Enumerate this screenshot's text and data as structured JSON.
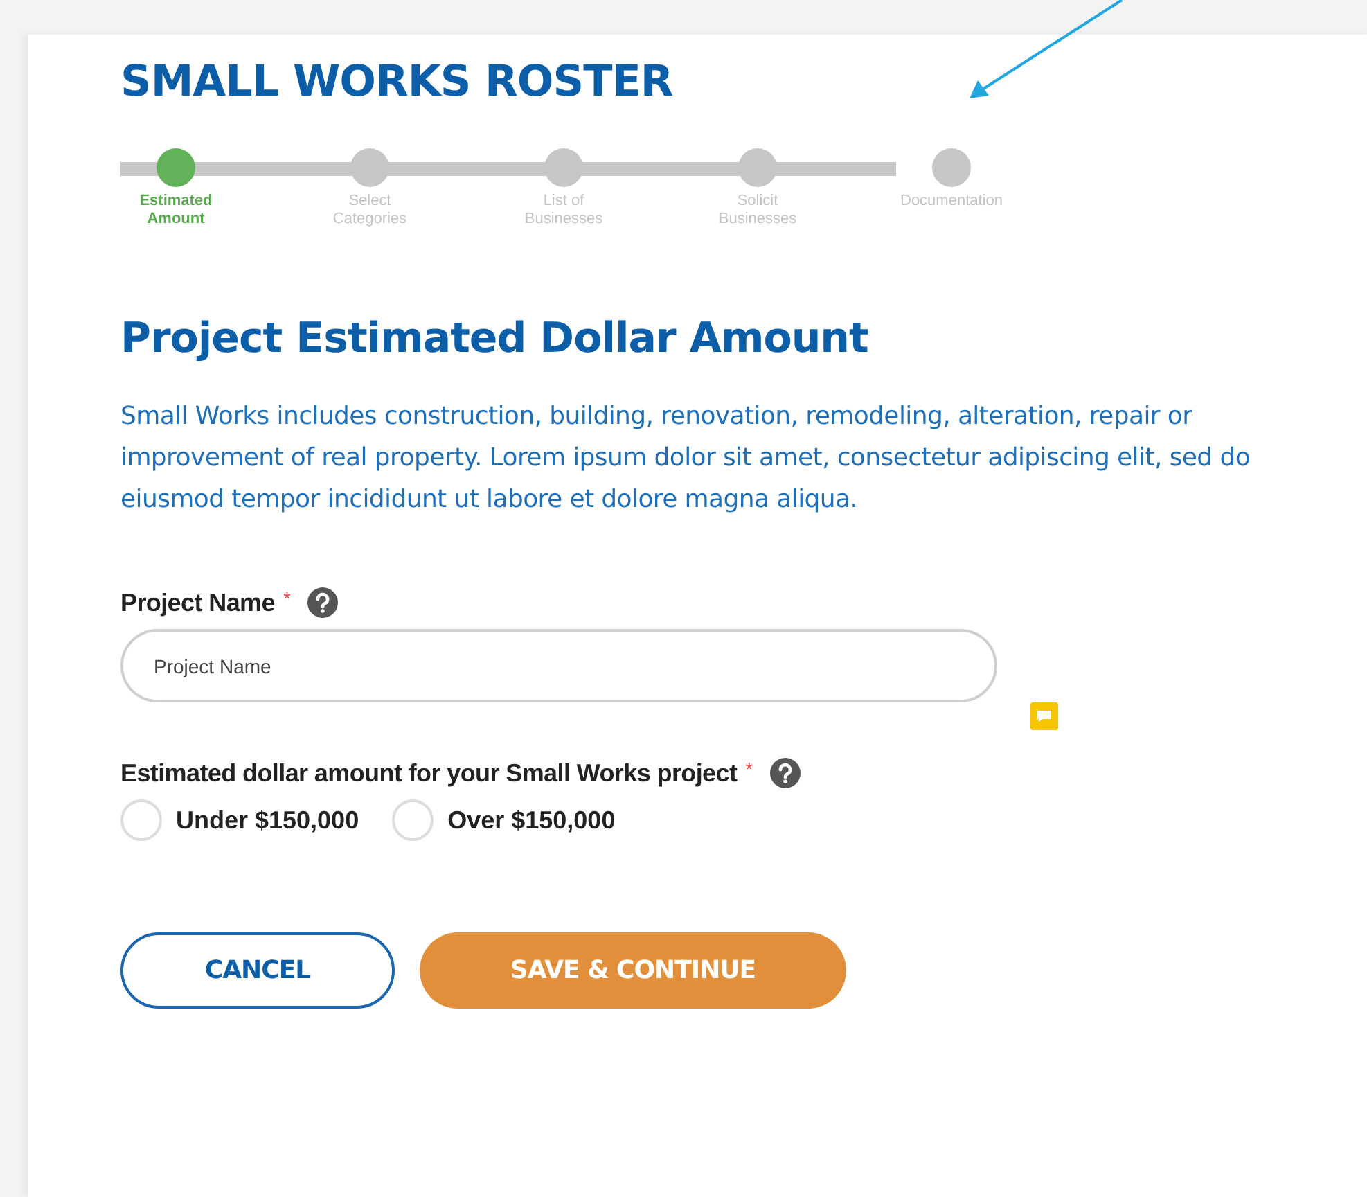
{
  "title": "SMALL WORKS ROSTER",
  "steps": [
    {
      "label": "Estimated\nAmount",
      "selected": true
    },
    {
      "label": "Select\nCategories",
      "selected": false
    },
    {
      "label": "List of\nBusinesses",
      "selected": false
    },
    {
      "label": "Solicit\nBusinesses",
      "selected": false
    },
    {
      "label": "Documentation",
      "selected": false
    }
  ],
  "heading": "Project Estimated Dollar Amount",
  "intro": "Small Works includes construction, building, renovation, remodeling, alteration, repair or improvement of real property. Lorem ipsum dolor sit amet, consectetur adipiscing elit, sed do eiusmod tempor incididunt ut labore et dolore magna aliqua.",
  "project_name": {
    "label": "Project Name",
    "required_mark": "*",
    "placeholder": "Project Name"
  },
  "amount": {
    "label": "Estimated dollar amount for your Small Works project",
    "required_mark": "*",
    "options": [
      {
        "label": "Under $150,000",
        "selected": false
      },
      {
        "label": "Over $150,000",
        "selected": false
      }
    ]
  },
  "buttons": [
    {
      "kind": "secondary",
      "label": "CANCEL"
    },
    {
      "kind": "primary",
      "label": "SAVE & CONTINUE"
    }
  ]
}
